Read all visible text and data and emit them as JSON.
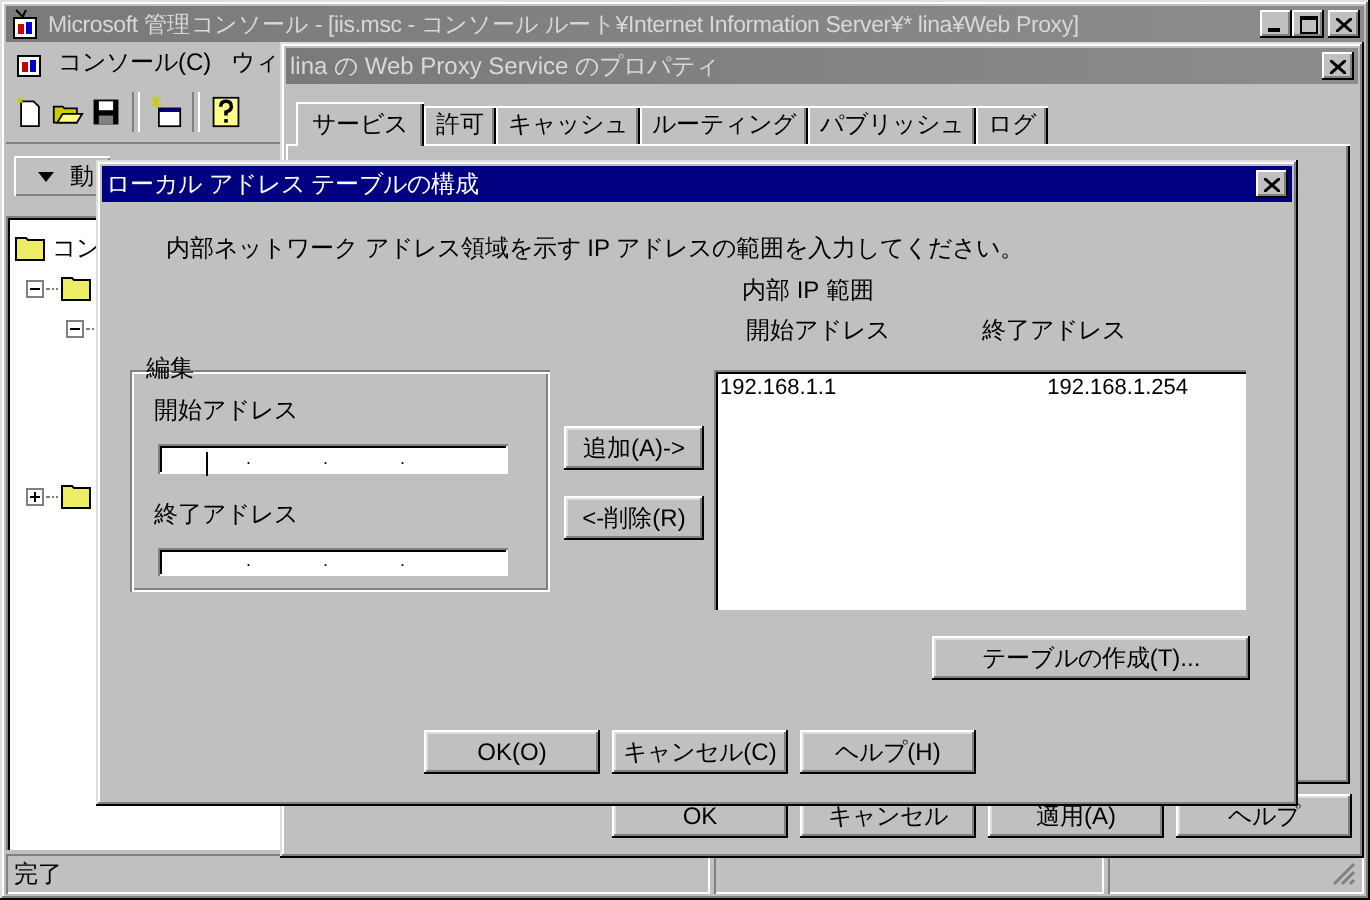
{
  "main_window": {
    "title": "Microsoft 管理コンソール - [iis.msc - コンソール ルート¥Internet Information Server¥* lina¥Web Proxy]",
    "menu": [
      "コンソール(C)",
      "ウィ"
    ],
    "action_menu": "動",
    "tree": [
      {
        "label": "コン",
        "children": [
          {
            "expanded": true,
            "children": [
              {
                "expanded": true
              }
            ]
          },
          {
            "expanded": false
          }
        ]
      }
    ],
    "status_bar": [
      "完了"
    ]
  },
  "properties_window": {
    "title": "lina の Web Proxy Service のプロパティ",
    "tabs": [
      {
        "label": "サービス",
        "selected": true
      },
      {
        "label": "許可",
        "selected": false
      },
      {
        "label": "キャッシュ",
        "selected": false
      },
      {
        "label": "ルーティング",
        "selected": false
      },
      {
        "label": "パブリッシュ",
        "selected": false
      },
      {
        "label": "ログ",
        "selected": false
      }
    ],
    "buttons": [
      "OK",
      "キャンセル",
      "適用(A)",
      "ヘルプ"
    ]
  },
  "dialog": {
    "title": "ローカル アドレス テーブルの構成",
    "instruction": "内部ネットワーク アドレス領域を示す IP アドレスの範囲を入力してください。",
    "group": "編集",
    "start_label": "開始アドレス",
    "start_field": {
      "focused": true,
      "separators": [
        ".",
        ".",
        "."
      ]
    },
    "end_label": "終了アドレス",
    "end_field": {
      "focused": false,
      "separators": [
        ".",
        ".",
        "."
      ]
    },
    "add_button": "追加(A)->",
    "remove_button": "<-削除(R)",
    "range_heading": "内部 IP 範囲",
    "columns": [
      "開始アドレス",
      "終了アドレス"
    ],
    "rows": [
      {
        "start": "192.168.1.1",
        "end": "192.168.1.254"
      }
    ],
    "create_table_button": "テーブルの作成(T)...",
    "buttons": [
      "OK(O)",
      "キャンセル(C)",
      "ヘルプ(H)"
    ]
  }
}
